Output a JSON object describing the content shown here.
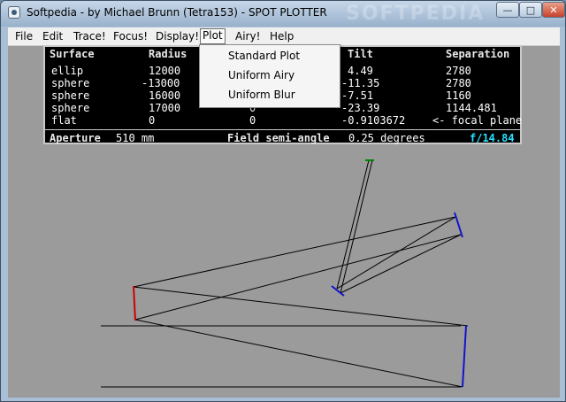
{
  "window": {
    "title": "Softpedia - by Michael Brunn (Tetra153) - SPOT PLOTTER",
    "watermark": "SOFTPEDIA"
  },
  "menu": {
    "items": [
      "File",
      "Edit",
      "Trace!",
      "Focus!",
      "Display!",
      "Plot",
      "Airy!",
      "Help"
    ],
    "active": "Plot",
    "dropdown": [
      "Standard Plot",
      "Uniform Airy",
      "Uniform Blur"
    ]
  },
  "table": {
    "headers": {
      "surface": "Surface",
      "radius": "Radius",
      "tilt": "Tilt",
      "separation": "Separation"
    },
    "rows": [
      {
        "surface": "ellip",
        "radius": "12000",
        "tilt": "4.49",
        "separation": "2780"
      },
      {
        "surface": "sphere",
        "radius": "-13000",
        "tilt": "-11.35",
        "separation": "2780"
      },
      {
        "surface": "sphere",
        "radius": "16000",
        "tilt": "-7.51",
        "separation": "1160"
      },
      {
        "surface": "sphere",
        "radius": "17000",
        "tilt": "-23.39",
        "separation": "1144.481"
      },
      {
        "surface": "flat",
        "radius": "0",
        "col3": "0",
        "tilt": "-0.9103672",
        "separation": "<- focal plane"
      }
    ],
    "partial_col": [
      "0",
      "0"
    ]
  },
  "footer": {
    "aperture_label": "Aperture",
    "aperture_value": "510 mm",
    "field_label": "Field semi-angle",
    "field_value": "0.25 degrees",
    "focal_ratio": "f/14.84"
  },
  "colors": {
    "panel_bg": "#000000",
    "focal_ratio": "#27e0ff",
    "mirror_red": "#cc0000",
    "mirror_blue": "#1414cc",
    "focal_green": "#008800"
  }
}
